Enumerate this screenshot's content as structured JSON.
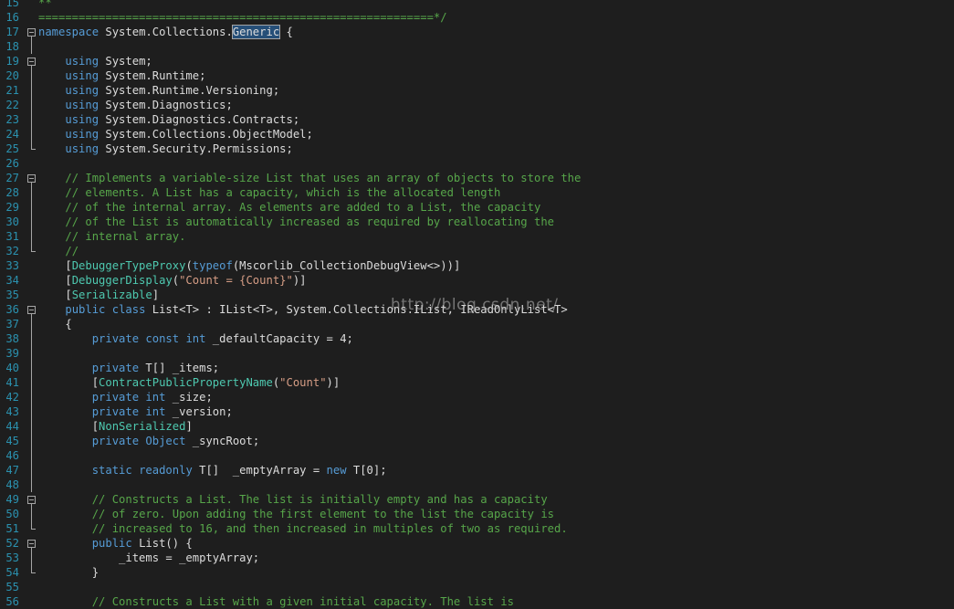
{
  "editor": {
    "lines": [
      {
        "n": "15",
        "tokens": [
          {
            "t": "**",
            "c": "cm"
          }
        ]
      },
      {
        "n": "16",
        "tokens": [
          {
            "t": "===========================================================*/",
            "c": "cm"
          }
        ]
      },
      {
        "n": "17",
        "fold": "start",
        "tokens": [
          {
            "t": "namespace",
            "c": "kw"
          },
          {
            "t": " System.Collections.",
            "c": "pl"
          },
          {
            "t": "Generic",
            "c": "pl hl"
          },
          {
            "t": " {",
            "c": "pl"
          }
        ]
      },
      {
        "n": "18",
        "tokens": []
      },
      {
        "n": "19",
        "fold": "start",
        "tokens": [
          {
            "t": "    ",
            "c": "pl"
          },
          {
            "t": "using",
            "c": "kw"
          },
          {
            "t": " System;",
            "c": "pl"
          }
        ]
      },
      {
        "n": "20",
        "tokens": [
          {
            "t": "    ",
            "c": "pl"
          },
          {
            "t": "using",
            "c": "kw"
          },
          {
            "t": " System.Runtime;",
            "c": "pl"
          }
        ]
      },
      {
        "n": "21",
        "tokens": [
          {
            "t": "    ",
            "c": "pl"
          },
          {
            "t": "using",
            "c": "kw"
          },
          {
            "t": " System.Runtime.Versioning;",
            "c": "pl"
          }
        ]
      },
      {
        "n": "22",
        "tokens": [
          {
            "t": "    ",
            "c": "pl"
          },
          {
            "t": "using",
            "c": "kw"
          },
          {
            "t": " System.Diagnostics;",
            "c": "pl"
          }
        ]
      },
      {
        "n": "23",
        "tokens": [
          {
            "t": "    ",
            "c": "pl"
          },
          {
            "t": "using",
            "c": "kw"
          },
          {
            "t": " System.Diagnostics.Contracts;",
            "c": "pl"
          }
        ]
      },
      {
        "n": "24",
        "tokens": [
          {
            "t": "    ",
            "c": "pl"
          },
          {
            "t": "using",
            "c": "kw"
          },
          {
            "t": " System.Collections.ObjectModel;",
            "c": "pl"
          }
        ]
      },
      {
        "n": "25",
        "fold": "end",
        "tokens": [
          {
            "t": "    ",
            "c": "pl"
          },
          {
            "t": "using",
            "c": "kw"
          },
          {
            "t": " System.Security.Permissions;",
            "c": "pl"
          }
        ]
      },
      {
        "n": "26",
        "tokens": []
      },
      {
        "n": "27",
        "fold": "start",
        "tokens": [
          {
            "t": "    ",
            "c": "pl"
          },
          {
            "t": "// Implements a variable-size List that uses an array of objects to store the",
            "c": "cm"
          }
        ]
      },
      {
        "n": "28",
        "tokens": [
          {
            "t": "    ",
            "c": "pl"
          },
          {
            "t": "// elements. A List has a capacity, which is the allocated length",
            "c": "cm"
          }
        ]
      },
      {
        "n": "29",
        "tokens": [
          {
            "t": "    ",
            "c": "pl"
          },
          {
            "t": "// of the internal array. As elements are added to a List, the capacity",
            "c": "cm"
          }
        ]
      },
      {
        "n": "30",
        "tokens": [
          {
            "t": "    ",
            "c": "pl"
          },
          {
            "t": "// of the List is automatically increased as required by reallocating the",
            "c": "cm"
          }
        ]
      },
      {
        "n": "31",
        "tokens": [
          {
            "t": "    ",
            "c": "pl"
          },
          {
            "t": "// internal array.",
            "c": "cm"
          }
        ]
      },
      {
        "n": "32",
        "fold": "end",
        "tokens": [
          {
            "t": "    ",
            "c": "pl"
          },
          {
            "t": "//",
            "c": "cm"
          }
        ]
      },
      {
        "n": "33",
        "tokens": [
          {
            "t": "    [",
            "c": "pl"
          },
          {
            "t": "DebuggerTypeProxy",
            "c": "ty"
          },
          {
            "t": "(",
            "c": "pl"
          },
          {
            "t": "typeof",
            "c": "kw"
          },
          {
            "t": "(Mscorlib_CollectionDebugView<>))]",
            "c": "pl"
          }
        ]
      },
      {
        "n": "34",
        "tokens": [
          {
            "t": "    [",
            "c": "pl"
          },
          {
            "t": "DebuggerDisplay",
            "c": "ty"
          },
          {
            "t": "(",
            "c": "pl"
          },
          {
            "t": "\"Count = {Count}\"",
            "c": "st"
          },
          {
            "t": ")]",
            "c": "pl"
          }
        ]
      },
      {
        "n": "35",
        "tokens": [
          {
            "t": "    [",
            "c": "pl"
          },
          {
            "t": "Serializable",
            "c": "ty"
          },
          {
            "t": "]",
            "c": "pl"
          }
        ]
      },
      {
        "n": "36",
        "fold": "start",
        "tokens": [
          {
            "t": "    ",
            "c": "pl"
          },
          {
            "t": "public",
            "c": "kw"
          },
          {
            "t": " ",
            "c": "pl"
          },
          {
            "t": "class",
            "c": "kw"
          },
          {
            "t": " List<T> : IList<T>, System.Collections.IList, IReadOnlyList<T>",
            "c": "pl"
          }
        ]
      },
      {
        "n": "37",
        "tokens": [
          {
            "t": "    {",
            "c": "pl"
          }
        ]
      },
      {
        "n": "38",
        "tokens": [
          {
            "t": "        ",
            "c": "pl"
          },
          {
            "t": "private",
            "c": "kw"
          },
          {
            "t": " ",
            "c": "pl"
          },
          {
            "t": "const",
            "c": "kw"
          },
          {
            "t": " ",
            "c": "pl"
          },
          {
            "t": "int",
            "c": "kw"
          },
          {
            "t": " _defaultCapacity = 4;",
            "c": "pl"
          }
        ]
      },
      {
        "n": "39",
        "tokens": []
      },
      {
        "n": "40",
        "tokens": [
          {
            "t": "        ",
            "c": "pl"
          },
          {
            "t": "private",
            "c": "kw"
          },
          {
            "t": " T[] _items;",
            "c": "pl"
          }
        ]
      },
      {
        "n": "41",
        "tokens": [
          {
            "t": "        [",
            "c": "pl"
          },
          {
            "t": "ContractPublicPropertyName",
            "c": "ty"
          },
          {
            "t": "(",
            "c": "pl"
          },
          {
            "t": "\"Count\"",
            "c": "st"
          },
          {
            "t": ")]",
            "c": "pl"
          }
        ]
      },
      {
        "n": "42",
        "tokens": [
          {
            "t": "        ",
            "c": "pl"
          },
          {
            "t": "private",
            "c": "kw"
          },
          {
            "t": " ",
            "c": "pl"
          },
          {
            "t": "int",
            "c": "kw"
          },
          {
            "t": " _size;",
            "c": "pl"
          }
        ]
      },
      {
        "n": "43",
        "tokens": [
          {
            "t": "        ",
            "c": "pl"
          },
          {
            "t": "private",
            "c": "kw"
          },
          {
            "t": " ",
            "c": "pl"
          },
          {
            "t": "int",
            "c": "kw"
          },
          {
            "t": " _version;",
            "c": "pl"
          }
        ]
      },
      {
        "n": "44",
        "tokens": [
          {
            "t": "        [",
            "c": "pl"
          },
          {
            "t": "NonSerialized",
            "c": "ty"
          },
          {
            "t": "]",
            "c": "pl"
          }
        ]
      },
      {
        "n": "45",
        "tokens": [
          {
            "t": "        ",
            "c": "pl"
          },
          {
            "t": "private",
            "c": "kw"
          },
          {
            "t": " ",
            "c": "pl"
          },
          {
            "t": "Object",
            "c": "kw"
          },
          {
            "t": " _syncRoot;",
            "c": "pl"
          }
        ]
      },
      {
        "n": "46",
        "tokens": []
      },
      {
        "n": "47",
        "tokens": [
          {
            "t": "        ",
            "c": "pl"
          },
          {
            "t": "static",
            "c": "kw"
          },
          {
            "t": " ",
            "c": "pl"
          },
          {
            "t": "readonly",
            "c": "kw"
          },
          {
            "t": " T[]  _emptyArray = ",
            "c": "pl"
          },
          {
            "t": "new",
            "c": "kw"
          },
          {
            "t": " T[0];",
            "c": "pl"
          }
        ]
      },
      {
        "n": "48",
        "tokens": []
      },
      {
        "n": "49",
        "fold": "start",
        "tokens": [
          {
            "t": "        ",
            "c": "pl"
          },
          {
            "t": "// Constructs a List. The list is initially empty and has a capacity",
            "c": "cm"
          }
        ]
      },
      {
        "n": "50",
        "tokens": [
          {
            "t": "        ",
            "c": "pl"
          },
          {
            "t": "// of zero. Upon adding the first element to the list the capacity is",
            "c": "cm"
          }
        ]
      },
      {
        "n": "51",
        "fold": "end",
        "tokens": [
          {
            "t": "        ",
            "c": "pl"
          },
          {
            "t": "// increased to 16, and then increased in multiples of two as required.",
            "c": "cm"
          }
        ]
      },
      {
        "n": "52",
        "fold": "start",
        "tokens": [
          {
            "t": "        ",
            "c": "pl"
          },
          {
            "t": "public",
            "c": "kw"
          },
          {
            "t": " List() {",
            "c": "pl"
          }
        ]
      },
      {
        "n": "53",
        "tokens": [
          {
            "t": "            _items = _emptyArray;",
            "c": "pl"
          }
        ]
      },
      {
        "n": "54",
        "fold": "end",
        "tokens": [
          {
            "t": "        }",
            "c": "pl"
          }
        ]
      },
      {
        "n": "55",
        "tokens": []
      },
      {
        "n": "56",
        "tokens": [
          {
            "t": "        ",
            "c": "pl"
          },
          {
            "t": "// Constructs a List with a given initial capacity. The list is",
            "c": "cm"
          }
        ]
      }
    ]
  },
  "watermark": "http://blog.csdn.net/",
  "colors": {
    "background": "#1e1e1e",
    "line_number": "#2b91af",
    "keyword": "#569cd6",
    "comment": "#57a64a",
    "type": "#4ec9b0",
    "string": "#d69d85",
    "text": "#dcdcdc"
  }
}
